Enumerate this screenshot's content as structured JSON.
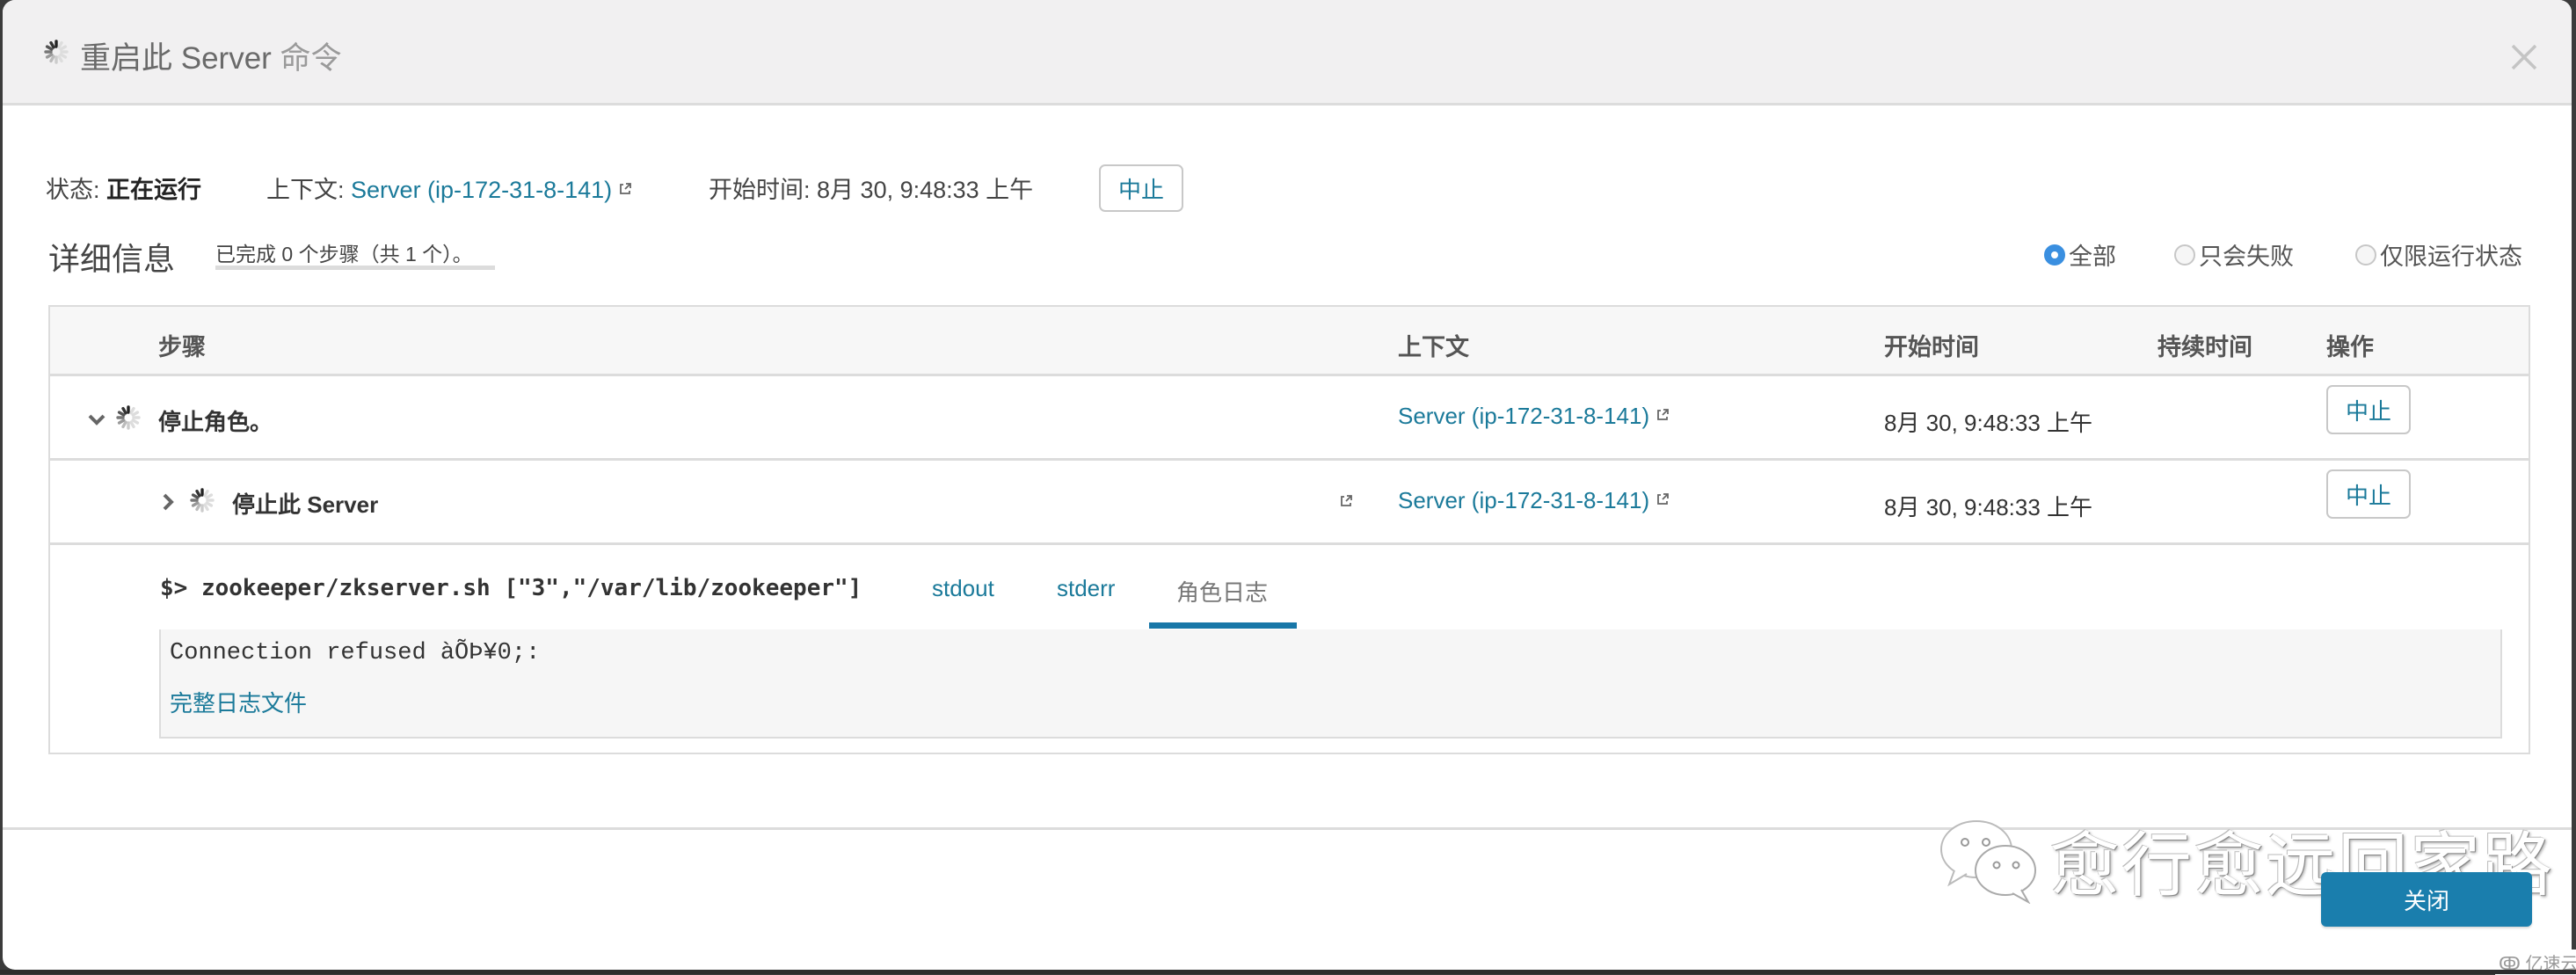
{
  "dialog": {
    "title_main": "重启此 Server",
    "title_suffix": "命令",
    "close_icon": "close-icon"
  },
  "status": {
    "state_label": "状态:",
    "state_value": "正在运行",
    "context_label": "上下文:",
    "context_link": "Server (ip-172-31-8-141)",
    "start_label": "开始时间:",
    "start_value": "8月 30, 9:48:33 上午",
    "abort_label": "中止"
  },
  "details": {
    "title": "详细信息",
    "summary": "已完成 0 个步骤（共 1 个）。",
    "progress": 0,
    "filters": [
      {
        "label": "全部",
        "selected": true
      },
      {
        "label": "只会失败",
        "selected": false
      },
      {
        "label": "仅限运行状态",
        "selected": false
      }
    ]
  },
  "table": {
    "headers": {
      "step": "步骤",
      "context": "上下文",
      "start_time": "开始时间",
      "duration": "持续时间",
      "actions": "操作"
    },
    "rows": [
      {
        "expanded": true,
        "step": "停止角色。",
        "context": "Server (ip-172-31-8-141)",
        "start_time": "8月 30, 9:48:33 上午",
        "duration": "",
        "action": "中止"
      },
      {
        "expanded": false,
        "step": "停止此 Server",
        "context": "Server (ip-172-31-8-141)",
        "start_time": "8月 30, 9:48:33 上午",
        "duration": "",
        "action": "中止"
      }
    ],
    "log": {
      "command": "$> zookeeper/zkserver.sh [\"3\",\"/var/lib/zookeeper\"]",
      "tabs": [
        {
          "label": "stdout",
          "active": false
        },
        {
          "label": "stderr",
          "active": false
        },
        {
          "label": "角色日志",
          "active": true
        }
      ],
      "output": "Connection refused àÕÞ¥0;:",
      "full_log_link": "完整日志文件"
    }
  },
  "footer": {
    "close_label": "关闭"
  },
  "watermark": {
    "text": "愈行愈远回家路",
    "brand": "亿速云"
  },
  "colors": {
    "link": "#1b7a9a",
    "primary": "#1a7ead",
    "radio_selected": "#3a8fe0",
    "header_bg": "#f1f0f1"
  }
}
